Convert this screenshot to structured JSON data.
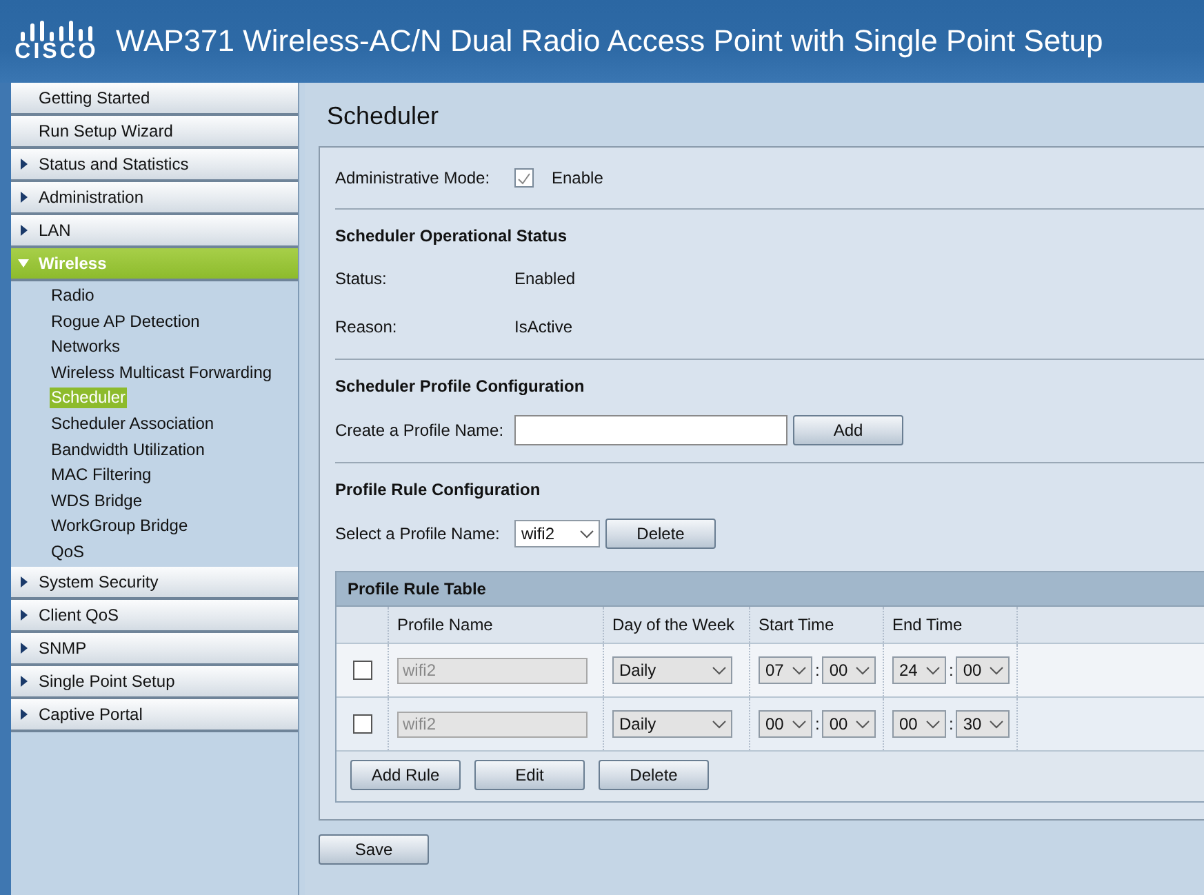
{
  "header": {
    "logo": "CISCO",
    "title": "WAP371 Wireless-AC/N Dual Radio Access Point with Single Point Setup"
  },
  "nav": [
    {
      "label": "Getting Started",
      "kind": "link",
      "expanded": false
    },
    {
      "label": "Run Setup Wizard",
      "kind": "link",
      "expanded": false
    },
    {
      "label": "Status and Statistics",
      "kind": "group",
      "expanded": false
    },
    {
      "label": "Administration",
      "kind": "group",
      "expanded": false
    },
    {
      "label": "LAN",
      "kind": "group",
      "expanded": false
    },
    {
      "label": "Wireless",
      "kind": "group",
      "expanded": true,
      "children": [
        {
          "label": "Radio",
          "selected": false
        },
        {
          "label": "Rogue AP Detection",
          "selected": false
        },
        {
          "label": "Networks",
          "selected": false
        },
        {
          "label": "Wireless Multicast Forwarding",
          "selected": false
        },
        {
          "label": "Scheduler",
          "selected": true
        },
        {
          "label": "Scheduler Association",
          "selected": false
        },
        {
          "label": "Bandwidth Utilization",
          "selected": false
        },
        {
          "label": "MAC Filtering",
          "selected": false
        },
        {
          "label": "WDS Bridge",
          "selected": false
        },
        {
          "label": "WorkGroup Bridge",
          "selected": false
        },
        {
          "label": "QoS",
          "selected": false
        }
      ]
    },
    {
      "label": "System Security",
      "kind": "group",
      "expanded": false
    },
    {
      "label": "Client QoS",
      "kind": "group",
      "expanded": false
    },
    {
      "label": "SNMP",
      "kind": "group",
      "expanded": false
    },
    {
      "label": "Single Point Setup",
      "kind": "group",
      "expanded": false
    },
    {
      "label": "Captive Portal",
      "kind": "group",
      "expanded": false
    }
  ],
  "page_title": "Scheduler",
  "admin_mode": {
    "label": "Administrative Mode:",
    "checked": true,
    "option": "Enable"
  },
  "status_section": {
    "heading": "Scheduler Operational Status",
    "rows": [
      {
        "label": "Status:",
        "value": "Enabled"
      },
      {
        "label": "Reason:",
        "value": "IsActive"
      }
    ]
  },
  "profile_section": {
    "heading": "Scheduler Profile Configuration",
    "label": "Create a Profile Name:",
    "button": "Add"
  },
  "rule_section": {
    "heading": "Profile Rule Configuration",
    "label": "Select a Profile Name:",
    "selected_profile": "wifi2",
    "button": "Delete"
  },
  "table": {
    "title": "Profile Rule Table",
    "columns": [
      "Profile Name",
      "Day of the Week",
      "Start Time",
      "End Time"
    ],
    "rows": [
      {
        "checked": false,
        "profile": "wifi2",
        "day": "Daily",
        "start_hour": "07",
        "start_minute": "00",
        "end_hour": "24",
        "end_minute": "00"
      },
      {
        "checked": false,
        "profile": "wifi2",
        "day": "Daily",
        "start_hour": "00",
        "start_minute": "00",
        "end_hour": "00",
        "end_minute": "30"
      }
    ],
    "separator": ":",
    "buttons": [
      "Add Rule",
      "Edit",
      "Delete"
    ]
  },
  "save_button": "Save"
}
